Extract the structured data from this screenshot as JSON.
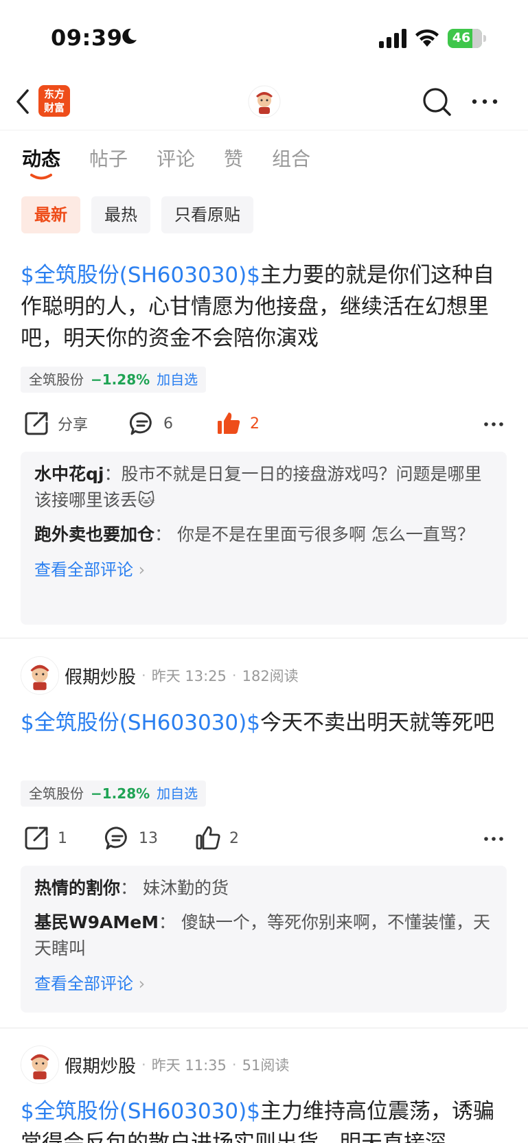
{
  "status_bar": {
    "time": "09:39",
    "battery": "46"
  },
  "nav": {
    "logo_text_line1": "东方",
    "logo_text_line2": "财富"
  },
  "tabs": [
    {
      "label": "动态",
      "active": true
    },
    {
      "label": "帖子",
      "active": false
    },
    {
      "label": "评论",
      "active": false
    },
    {
      "label": "赞",
      "active": false
    },
    {
      "label": "组合",
      "active": false
    }
  ],
  "chips": [
    {
      "label": "最新",
      "active": true
    },
    {
      "label": "最热",
      "active": false
    },
    {
      "label": "只看原贴",
      "active": false
    }
  ],
  "colors": {
    "brand": "#ee4d1a",
    "link": "#2a7ff0",
    "down": "#1fa354"
  },
  "posts": [
    {
      "stock_link": "$全筑股份(SH603030)$",
      "text": "主力要的就是你们这种自作聪明的人，心甘情愿为他接盘，继续活在幻想里吧，明天你的资金不会陪你演戏",
      "tag": {
        "name": "全筑股份",
        "change": "−1.28%",
        "add": "加自选"
      },
      "share_label": "分享",
      "comment_count": "6",
      "like_count": "2",
      "comments": [
        {
          "author": "水中花qj",
          "text": "股市不就是日复一日的接盘游戏吗？问题是哪里该接哪里该丢",
          "emoji": "🐱"
        },
        {
          "author": "跑外卖也要加仓",
          "text": "你是不是在里面亏很多啊 怎么一直骂？"
        }
      ],
      "view_all": "查看全部评论"
    },
    {
      "author": "假期炒股",
      "time": "昨天 13:25",
      "reads": "182阅读",
      "stock_link": "$全筑股份(SH603030)$",
      "text": "今天不卖出明天就等死吧",
      "tag": {
        "name": "全筑股份",
        "change": "−1.28%",
        "add": "加自选"
      },
      "share_count": "1",
      "comment_count": "13",
      "like_count": "2",
      "comments": [
        {
          "author": "热情的割你",
          "text": "妹沐勤的货"
        },
        {
          "author": "基民W9AMeM",
          "text": "傻缺一个，等死你别来啊，不懂装懂，天天瞎叫"
        }
      ],
      "view_all": "查看全部评论"
    },
    {
      "author": "假期炒股",
      "time": "昨天 11:35",
      "reads": "51阅读",
      "stock_link": "$全筑股份(SH603030)$",
      "text": "主力维持高位震荡，诱骗常得会反包的散户进场实则出货，明天直接深"
    }
  ]
}
